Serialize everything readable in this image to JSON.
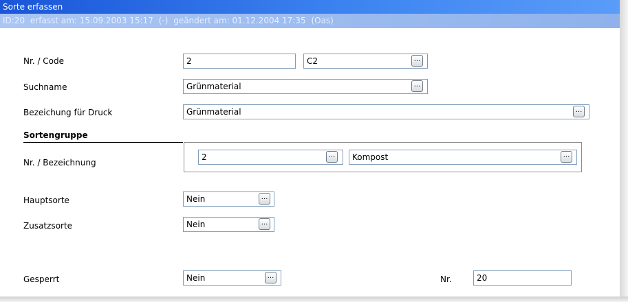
{
  "window": {
    "title": "Sorte erfassen"
  },
  "info": {
    "id": "ID:20",
    "created": "erfasst am: 15.09.2003 15:17",
    "created_by": "(-)",
    "changed": "geändert am: 01.12.2004 17:35",
    "changed_by": "(Oas)"
  },
  "fields": {
    "nr_code": {
      "label": "Nr. / Code",
      "nr": "2",
      "code": "C2"
    },
    "suchname": {
      "label": "Suchname",
      "value": "Grünmaterial"
    },
    "druck": {
      "label": "Bezeichung für Druck",
      "value": "Grünmaterial"
    },
    "sortengruppe": {
      "heading": "Sortengruppe",
      "label": "Nr. / Bezeichnung",
      "nr": "2",
      "bezeichnung": "Kompost"
    },
    "hauptsorte": {
      "label": "Hauptsorte",
      "value": "Nein"
    },
    "zusatzsorte": {
      "label": "Zusatzsorte",
      "value": "Nein"
    },
    "gesperrt": {
      "label": "Gesperrt",
      "value": "Nein",
      "nr_label": "Nr.",
      "nr_value": "20"
    }
  },
  "lookup_button_label": "...",
  "icons": {
    "lookup": "ellipsis-button-icon"
  },
  "colors": {
    "titlebar": "#1a56d8",
    "infobar": "#9bbcf0",
    "field_border": "#7f9db9"
  }
}
